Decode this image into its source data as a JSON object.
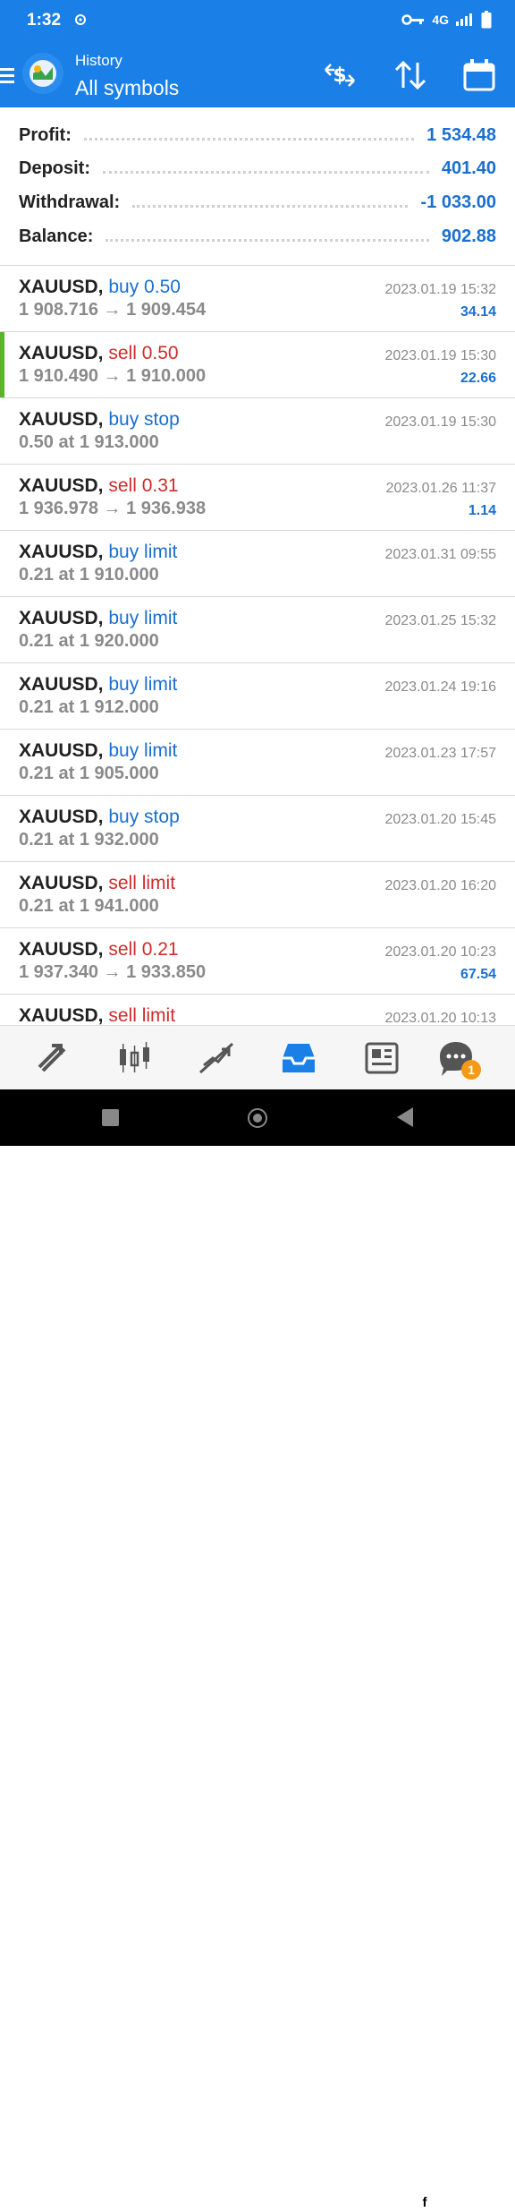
{
  "status_bar": {
    "time": "1:32",
    "network": "4G"
  },
  "header": {
    "subtitle": "History",
    "title": "All symbols"
  },
  "summary": [
    {
      "label": "Profit:",
      "value": "1 534.48"
    },
    {
      "label": "Deposit:",
      "value": "401.40"
    },
    {
      "label": "Withdrawal:",
      "value": "-1 033.00"
    },
    {
      "label": "Balance:",
      "value": "902.88"
    }
  ],
  "deals": [
    {
      "symbol": "XAUUSD,",
      "action": "buy 0.50",
      "side": "buy",
      "detail": "1 908.716 → 1 909.454",
      "datetime": "2023.01.19 15:32",
      "profit": "34.14"
    },
    {
      "symbol": "XAUUSD,",
      "action": "sell 0.50",
      "side": "sell",
      "detail": "1 910.490 → 1 910.000",
      "datetime": "2023.01.19 15:30",
      "profit": "22.66"
    },
    {
      "symbol": "XAUUSD,",
      "action": "buy stop",
      "side": "buy",
      "detail": "0.50 at 1 913.000",
      "datetime": "2023.01.19 15:30",
      "profit": ""
    },
    {
      "symbol": "XAUUSD,",
      "action": "sell 0.31",
      "side": "sell",
      "detail": "1 936.978 → 1 936.938",
      "datetime": "2023.01.26 11:37",
      "profit": "1.14"
    },
    {
      "symbol": "XAUUSD,",
      "action": "buy limit",
      "side": "buy",
      "detail": "0.21 at 1 910.000",
      "datetime": "2023.01.31 09:55",
      "profit": ""
    },
    {
      "symbol": "XAUUSD,",
      "action": "buy limit",
      "side": "buy",
      "detail": "0.21 at 1 920.000",
      "datetime": "2023.01.25 15:32",
      "profit": ""
    },
    {
      "symbol": "XAUUSD,",
      "action": "buy limit",
      "side": "buy",
      "detail": "0.21 at 1 912.000",
      "datetime": "2023.01.24 19:16",
      "profit": ""
    },
    {
      "symbol": "XAUUSD,",
      "action": "buy limit",
      "side": "buy",
      "detail": "0.21 at 1 905.000",
      "datetime": "2023.01.23 17:57",
      "profit": ""
    },
    {
      "symbol": "XAUUSD,",
      "action": "buy stop",
      "side": "buy",
      "detail": "0.21 at 1 932.000",
      "datetime": "2023.01.20 15:45",
      "profit": ""
    },
    {
      "symbol": "XAUUSD,",
      "action": "sell limit",
      "side": "sell",
      "detail": "0.21 at 1 941.000",
      "datetime": "2023.01.20 16:20",
      "profit": ""
    },
    {
      "symbol": "XAUUSD,",
      "action": "sell 0.21",
      "side": "sell",
      "detail": "1 937.340 → 1 933.850",
      "datetime": "2023.01.20 10:23",
      "profit": "67.54"
    },
    {
      "symbol": "XAUUSD,",
      "action": "sell limit",
      "side": "sell",
      "detail": "",
      "datetime": "2023.01.20 10:13",
      "profit": ""
    }
  ],
  "bottom_nav": {
    "items": [
      "quotes-icon",
      "chart-icon",
      "trade-icon",
      "history-icon",
      "news-icon",
      "messages-icon"
    ],
    "badge": "1"
  },
  "watermark": "@Jotafx",
  "colors": {
    "accent": "#1a7fe6",
    "buy": "#1a6fd0",
    "sell": "#d12b2b",
    "highlight": "#59b32b"
  }
}
